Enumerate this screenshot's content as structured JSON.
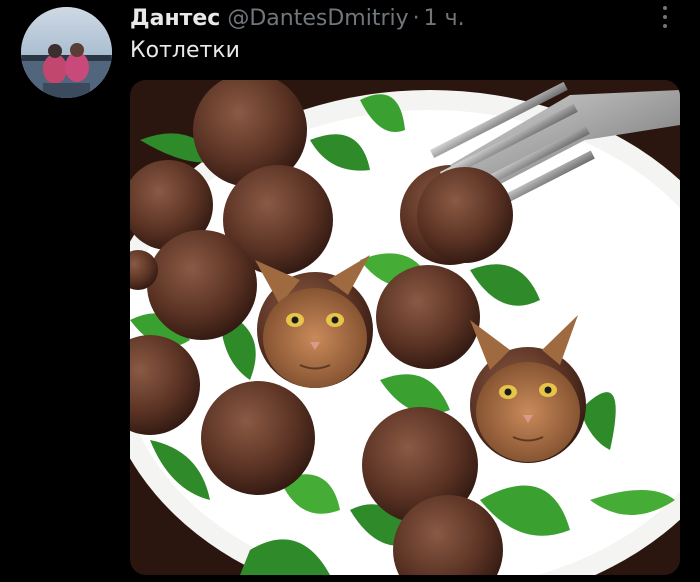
{
  "tweet": {
    "author": {
      "display_name": "Дантес",
      "handle": "@DantesDmitriy",
      "avatar_icon": "profile-avatar"
    },
    "separator": "·",
    "time": "1 ч.",
    "text": "Котлетки",
    "more_icon": "vertical-dots-icon",
    "media": {
      "type": "photo",
      "subject_icons": [
        "meatball",
        "cat-face",
        "fork",
        "arugula-leaf",
        "plate"
      ]
    }
  },
  "colors": {
    "background": "#000000",
    "primary_text": "#e7e9ea",
    "secondary_text": "#71767b"
  }
}
